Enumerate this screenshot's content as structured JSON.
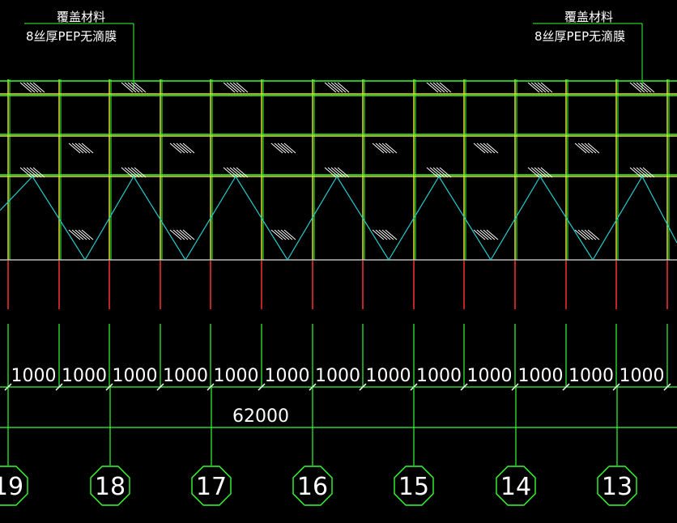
{
  "annotations": [
    {
      "title": "覆盖材料",
      "subtitle": "8丝厚PEP无滴膜"
    },
    {
      "title": "覆盖材料",
      "subtitle": "8丝厚PEP无滴膜"
    }
  ],
  "dimensions": {
    "segments": [
      "0",
      "1000",
      "1000",
      "1000",
      "1000",
      "1000",
      "1000",
      "1000",
      "1000",
      "1000",
      "1000",
      "1000",
      "1000",
      "1000",
      "0"
    ],
    "total": "62000"
  },
  "axes": [
    "19",
    "18",
    "17",
    "16",
    "15",
    "14",
    "13"
  ],
  "colors": {
    "background": "#000000",
    "frame": "#33ff33",
    "post": "#e0e033",
    "truss": "#22cccc",
    "red": "#ff3030",
    "white": "#ffffff"
  }
}
